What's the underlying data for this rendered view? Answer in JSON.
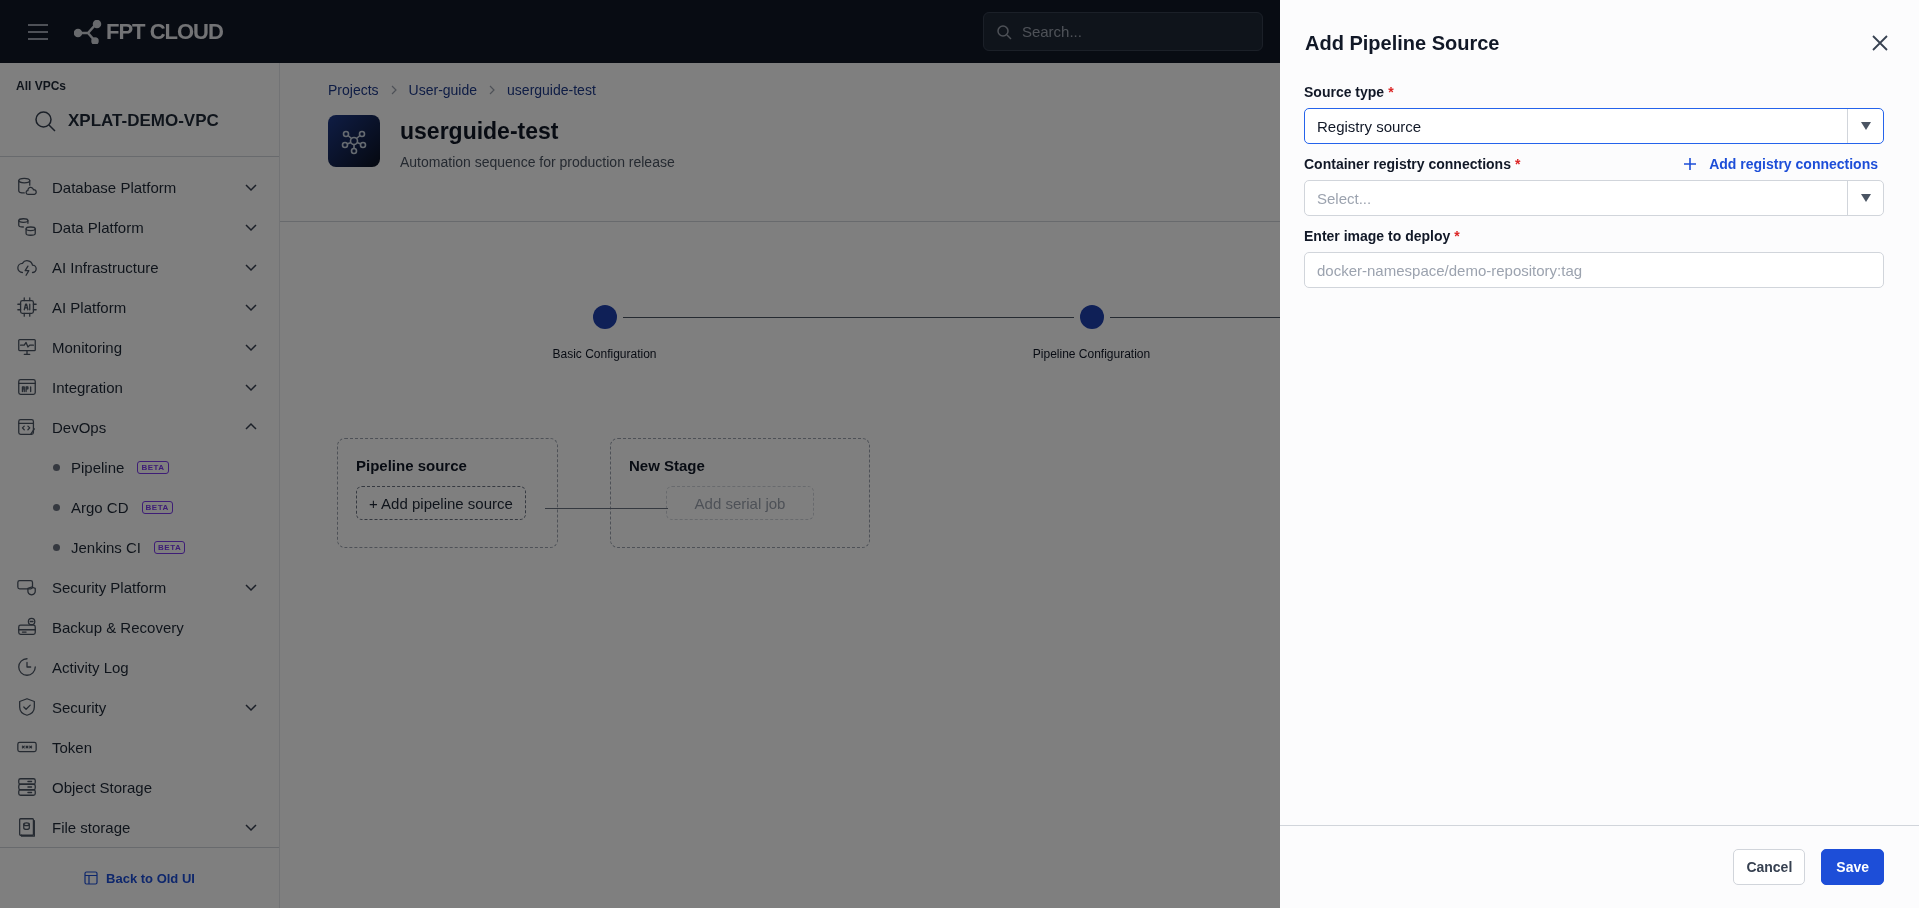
{
  "header": {
    "logo": "FPT CLOUD",
    "search": {
      "placeholder": "Search..."
    }
  },
  "sidebar": {
    "vpc_label": "All VPCs",
    "vpc_name": "XPLAT-DEMO-VPC",
    "items": [
      {
        "label": "Database Platform",
        "kind": "group",
        "expanded": false
      },
      {
        "label": "Data Platform",
        "kind": "group",
        "expanded": false
      },
      {
        "label": "AI Infrastructure",
        "kind": "group",
        "expanded": false
      },
      {
        "label": "AI Platform",
        "kind": "group",
        "expanded": false
      },
      {
        "label": "Monitoring",
        "kind": "group",
        "expanded": false
      },
      {
        "label": "Integration",
        "kind": "group",
        "expanded": false
      },
      {
        "label": "DevOps",
        "kind": "group",
        "expanded": true,
        "children": [
          {
            "label": "Pipeline",
            "badge": "BETA"
          },
          {
            "label": "Argo CD",
            "badge": "BETA"
          },
          {
            "label": "Jenkins CI",
            "badge": "BETA"
          }
        ]
      },
      {
        "label": "Security Platform",
        "kind": "group",
        "expanded": false
      },
      {
        "label": "Backup & Recovery",
        "kind": "link"
      },
      {
        "label": "Activity Log",
        "kind": "link"
      },
      {
        "label": "Security",
        "kind": "group",
        "expanded": false
      },
      {
        "label": "Token",
        "kind": "link"
      },
      {
        "label": "Object Storage",
        "kind": "link"
      },
      {
        "label": "File storage",
        "kind": "group",
        "expanded": false
      }
    ],
    "footer_link": "Back to Old UI"
  },
  "main": {
    "breadcrumbs": [
      "Projects",
      "User-guide",
      "userguide-test"
    ],
    "title": "userguide-test",
    "description": "Automation sequence for production release",
    "steps": [
      {
        "label": "Basic Configuration"
      },
      {
        "label": "Pipeline Configuration"
      }
    ],
    "stages": [
      {
        "title": "Pipeline source",
        "action": {
          "label": "+ Add pipeline source",
          "disabled": false
        }
      },
      {
        "title": "New Stage",
        "action": {
          "label": "Add serial job",
          "disabled": true
        }
      }
    ]
  },
  "drawer": {
    "title": "Add Pipeline Source",
    "fields": [
      {
        "label": "Source type",
        "required_mark": "*",
        "kind": "select",
        "value": "Registry source",
        "focused": true
      },
      {
        "label": "Container registry connections",
        "required_mark": "*",
        "kind": "select",
        "placeholder": "Select...",
        "focused": false,
        "action": "Add registry connections"
      },
      {
        "label": "Enter image to deploy",
        "required_mark": "*",
        "kind": "text",
        "placeholder": "docker-namespace/demo-repository:tag",
        "focused": false
      }
    ],
    "buttons": [
      {
        "label": "Cancel",
        "kind": "secondary"
      },
      {
        "label": "Save",
        "kind": "primary"
      }
    ]
  }
}
